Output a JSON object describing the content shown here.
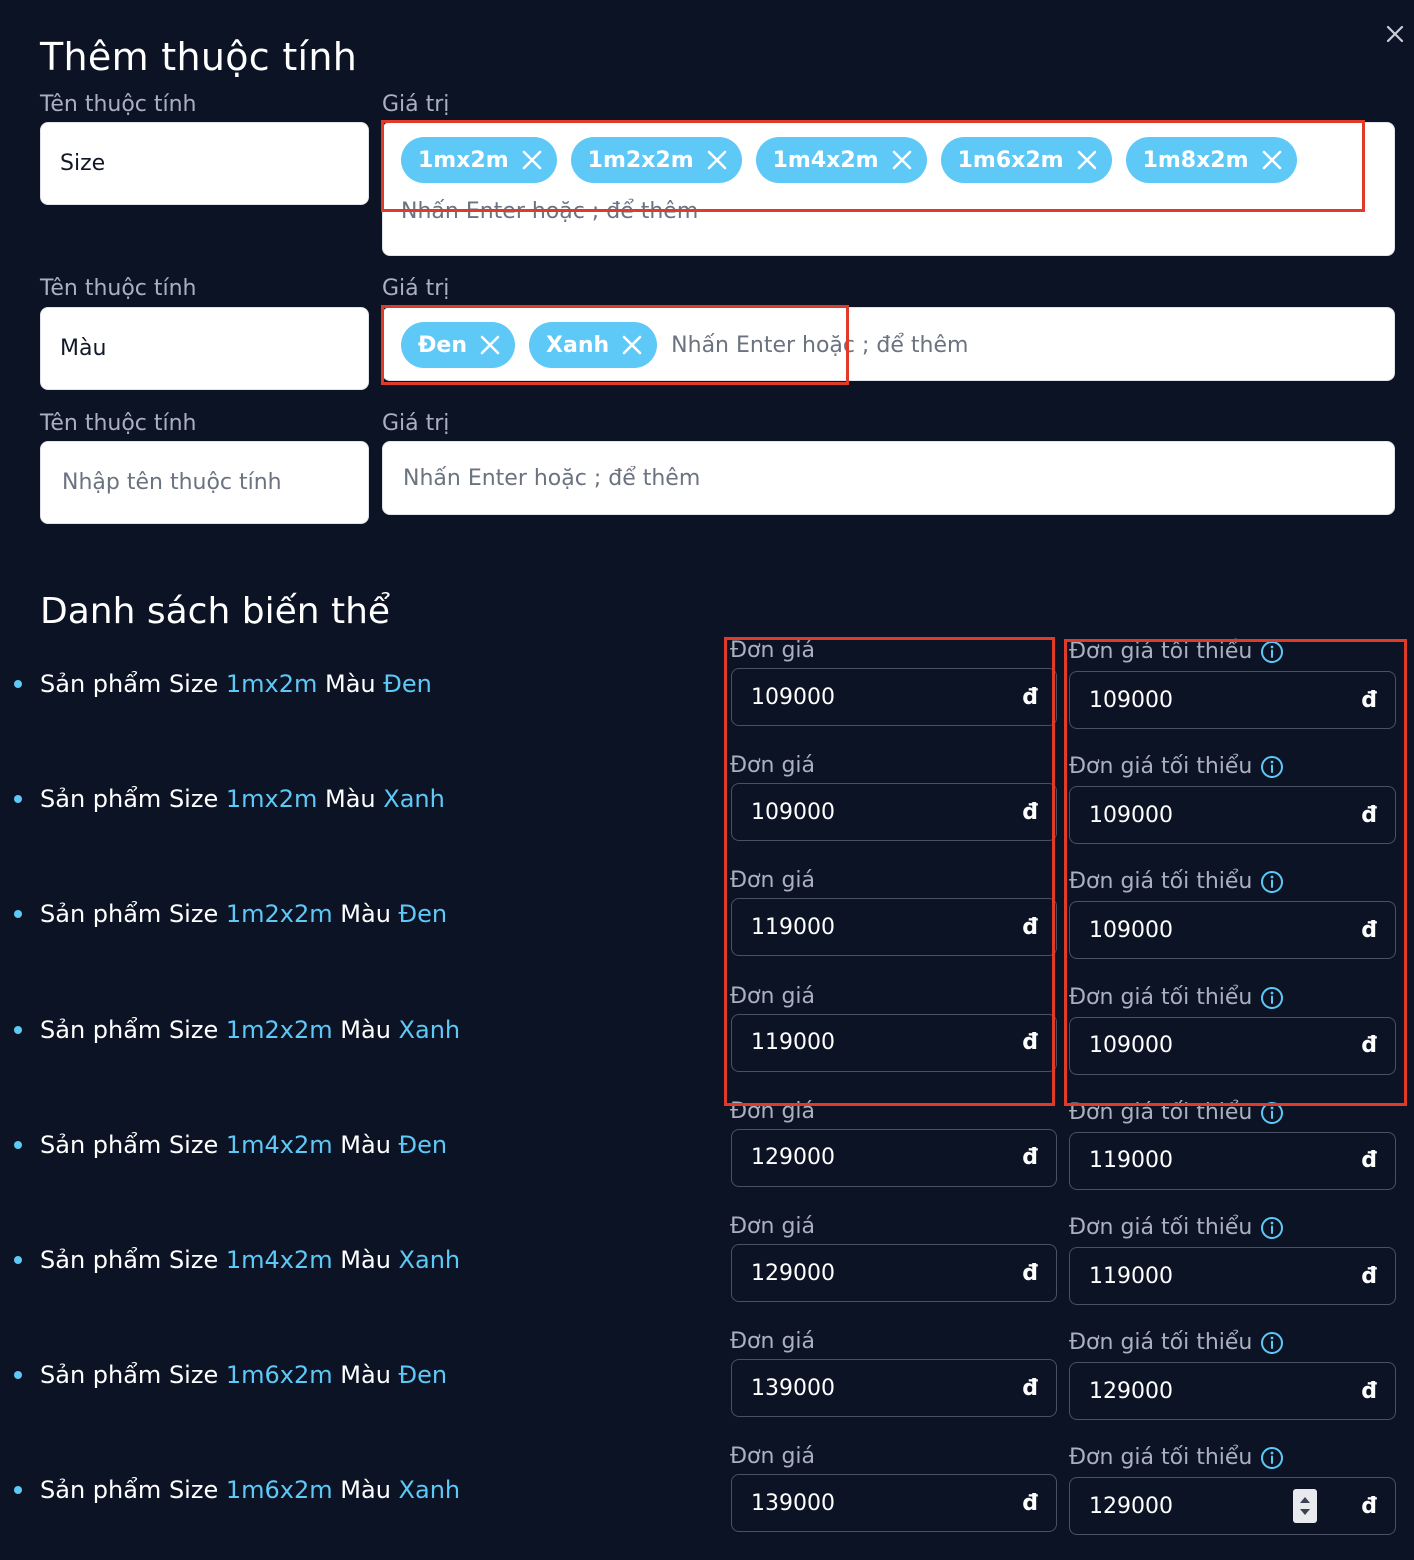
{
  "dialog": {
    "title": "Thêm thuộc tính",
    "close_icon": "close-icon"
  },
  "attributes": {
    "name_label": "Tên thuộc tính",
    "value_label": "Giá trị",
    "value_placeholder": "Nhấn Enter hoặc ; để thêm",
    "name_placeholder": "Nhập tên thuộc tính",
    "rows": [
      {
        "name": "Size",
        "values": [
          "1mx2m",
          "1m2x2m",
          "1m4x2m",
          "1m6x2m",
          "1m8x2m"
        ]
      },
      {
        "name": "Màu",
        "values": [
          "Đen",
          "Xanh"
        ]
      },
      {
        "name": "",
        "values": []
      }
    ]
  },
  "variants": {
    "title": "Danh sách biến thể",
    "prefix": "Sản phẩm Size",
    "color_word": "Màu",
    "price_label": "Đơn giá",
    "min_price_label": "Đơn giá tối thiểu",
    "currency": "đ",
    "items": [
      {
        "size": "1mx2m",
        "color": "Đen",
        "price": "109000",
        "min_price": "109000"
      },
      {
        "size": "1mx2m",
        "color": "Xanh",
        "price": "109000",
        "min_price": "109000"
      },
      {
        "size": "1m2x2m",
        "color": "Đen",
        "price": "119000",
        "min_price": "109000"
      },
      {
        "size": "1m2x2m",
        "color": "Xanh",
        "price": "119000",
        "min_price": "109000"
      },
      {
        "size": "1m4x2m",
        "color": "Đen",
        "price": "129000",
        "min_price": "119000"
      },
      {
        "size": "1m4x2m",
        "color": "Xanh",
        "price": "129000",
        "min_price": "119000"
      },
      {
        "size": "1m6x2m",
        "color": "Đen",
        "price": "139000",
        "min_price": "129000"
      },
      {
        "size": "1m6x2m",
        "color": "Xanh",
        "price": "139000",
        "min_price": "129000"
      }
    ]
  },
  "colors": {
    "background": "#0c1324",
    "accent": "#5ec8f7",
    "highlight_box": "#e03a2b"
  }
}
